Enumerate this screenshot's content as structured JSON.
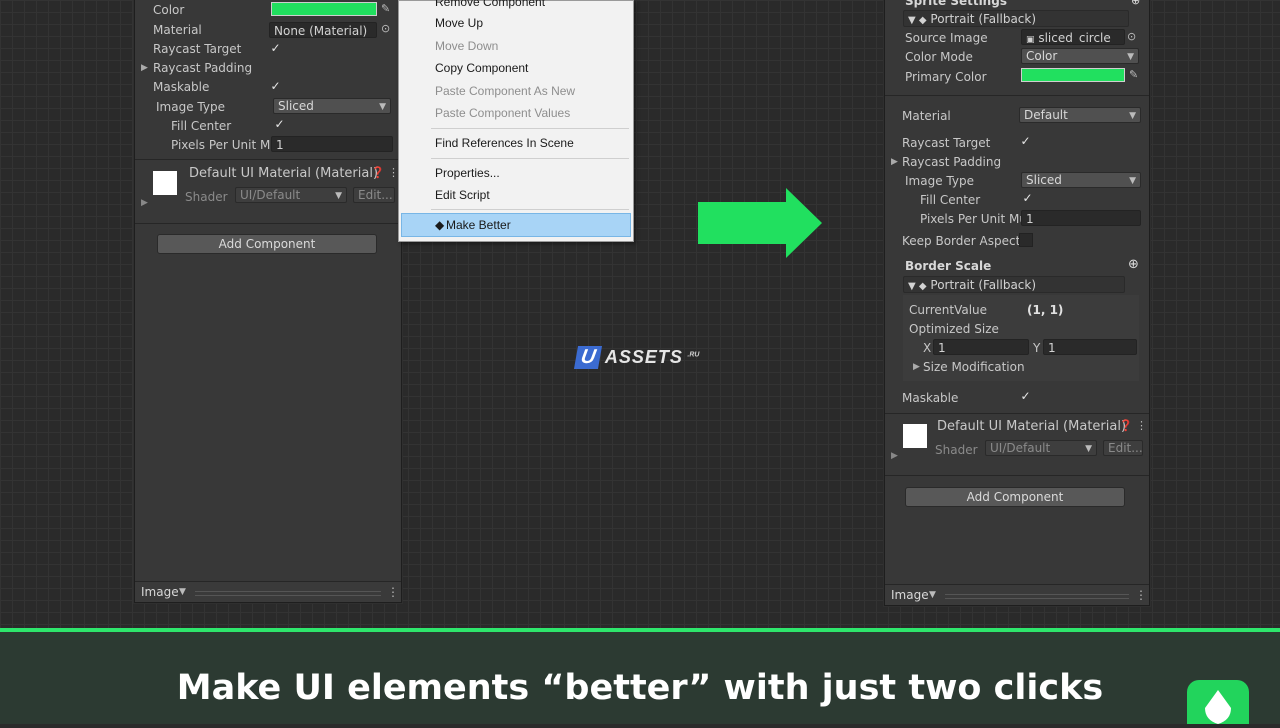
{
  "left_panel": {
    "color_label": "Color",
    "material_label": "Material",
    "material_value": "None (Material)",
    "raycast_target_label": "Raycast Target",
    "raycast_padding_label": "Raycast Padding",
    "maskable_label": "Maskable",
    "image_type_label": "Image Type",
    "image_type_value": "Sliced",
    "fill_center_label": "Fill Center",
    "ppum_label": "Pixels Per Unit Mul",
    "ppum_value": "1",
    "material_asset_title": "Default UI Material (Material)",
    "shader_label": "Shader",
    "shader_value": "UI/Default",
    "edit_label": "Edit...",
    "add_component": "Add Component",
    "footer_label": "Image"
  },
  "context_menu": {
    "items": [
      {
        "label": "Remove Component",
        "enabled": true
      },
      {
        "label": "Move Up",
        "enabled": true
      },
      {
        "label": "Move Down",
        "enabled": false
      },
      {
        "label": "Copy Component",
        "enabled": true
      },
      {
        "label": "Paste Component As New",
        "enabled": false
      },
      {
        "label": "Paste Component Values",
        "enabled": false
      },
      {
        "label": "Find References In Scene",
        "enabled": true
      },
      {
        "label": "Properties...",
        "enabled": true
      },
      {
        "label": "Edit Script",
        "enabled": true
      },
      {
        "label": "Make Better",
        "enabled": true,
        "highlighted": true,
        "icon": "diamond-icon"
      }
    ]
  },
  "right_panel": {
    "sprite_settings_label": "Sprite Settings",
    "portrait_label": "Portrait (Fallback)",
    "source_image_label": "Source Image",
    "source_image_value": "sliced_circle",
    "color_mode_label": "Color Mode",
    "color_mode_value": "Color",
    "primary_color_label": "Primary Color",
    "material_label": "Material",
    "material_value": "Default",
    "raycast_target_label": "Raycast Target",
    "raycast_padding_label": "Raycast Padding",
    "image_type_label": "Image Type",
    "image_type_value": "Sliced",
    "fill_center_label": "Fill Center",
    "ppum_label": "Pixels Per Unit Mul",
    "ppum_value": "1",
    "keep_border_label": "Keep Border Aspect R",
    "border_scale_label": "Border Scale",
    "portrait2_label": "Portrait (Fallback)",
    "current_value_label": "CurrentValue",
    "current_value": "(1, 1)",
    "optimized_size_label": "Optimized Size",
    "x_label": "X",
    "x_value": "1",
    "y_label": "Y",
    "y_value": "1",
    "size_mod_label": "Size Modification",
    "maskable_label": "Maskable",
    "material_asset_title": "Default UI Material (Material)",
    "shader_label": "Shader",
    "shader_value": "UI/Default",
    "edit_label": "Edit...",
    "add_component": "Add Component",
    "footer_label": "Image"
  },
  "watermark": {
    "u": "U",
    "text": "ASSETS",
    "suffix": ".RU"
  },
  "caption": "Make UI elements “better” with just two clicks",
  "colors": {
    "accent_green": "#21e05f",
    "menu_highlight": "#a8d4f6",
    "caption_bg": "#2c3a32"
  }
}
